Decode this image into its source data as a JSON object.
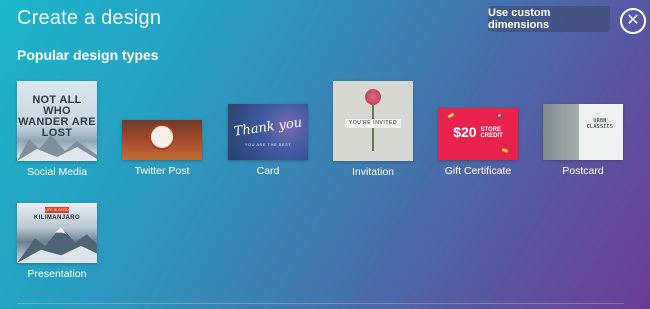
{
  "header": {
    "title": "Create a design",
    "custom_dimensions_label": "Use custom dimensions",
    "close_icon": "close-icon"
  },
  "section": {
    "title": "Popular design types"
  },
  "designs": [
    {
      "label": "Social Media",
      "thumb_text": "NOT ALL WHO WANDER ARE LOST"
    },
    {
      "label": "Twitter Post"
    },
    {
      "label": "Card",
      "thumb_text": "Thank you",
      "thumb_subtext": "YOU ARE THE BEST"
    },
    {
      "label": "Invitation",
      "thumb_text": "YOU'RE INVITED"
    },
    {
      "label": "Gift Certificate",
      "thumb_amount": "$20",
      "thumb_text_1": "STORE",
      "thumb_text_2": "CREDIT"
    },
    {
      "label": "Postcard",
      "thumb_text": "URBN CLASSICS"
    },
    {
      "label": "Presentation",
      "thumb_tag": "LIFE IS GOOD",
      "thumb_text": "KILIMANJARO"
    }
  ],
  "colors": {
    "gift_card": "#e8234e",
    "accent_yellow": "#f8d236"
  }
}
